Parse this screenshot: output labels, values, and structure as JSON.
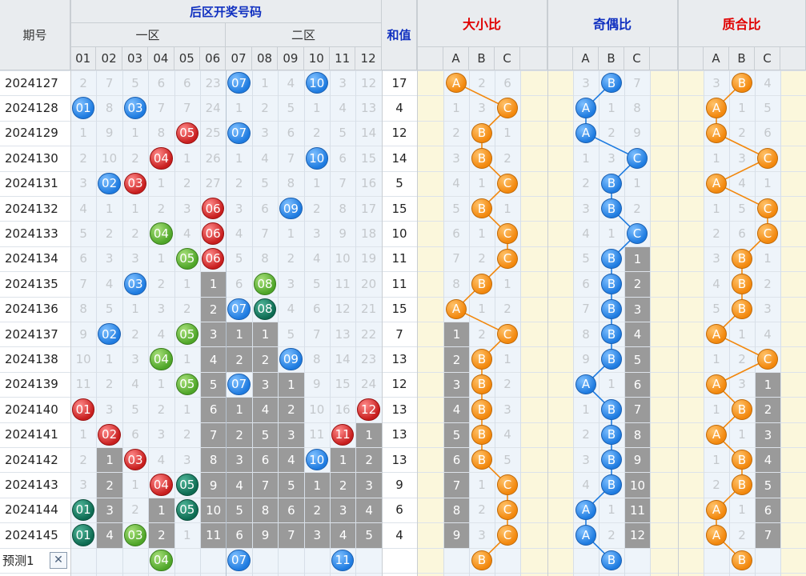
{
  "headers": {
    "period": "期号",
    "back_zone": "后区开奖号码",
    "zone1": "一区",
    "zone2": "二区",
    "sum": "和值",
    "big_small": "大小比",
    "odd_even": "奇偶比",
    "prime_composite": "质合比",
    "nums": [
      "01",
      "02",
      "03",
      "04",
      "05",
      "06",
      "07",
      "08",
      "09",
      "10",
      "11",
      "12"
    ],
    "abc": [
      "A",
      "B",
      "C"
    ]
  },
  "colors": {
    "blue": "#1e7be0",
    "red": "#c81e1e",
    "green": "#4ea528",
    "teal": "#0d6b52",
    "orange": "#f2870c",
    "dark": "#9a9a9a"
  },
  "rows": [
    {
      "period": "2024127",
      "cells": [
        "2",
        "7",
        "5",
        "6",
        "6",
        "23",
        "07",
        "1",
        "4",
        "10",
        "3",
        "12"
      ],
      "sum": "17",
      "bs": [
        "A",
        "2",
        "6"
      ],
      "oe": [
        "3",
        "B",
        "7"
      ],
      "pc": [
        "3",
        "B",
        "4"
      ]
    },
    {
      "period": "2024128",
      "cells": [
        "01",
        "8",
        "03",
        "7",
        "7",
        "24",
        "1",
        "2",
        "5",
        "1",
        "4",
        "13"
      ],
      "sum": "4",
      "bs": [
        "1",
        "3",
        "C"
      ],
      "oe": [
        "A",
        "1",
        "8"
      ],
      "pc": [
        "A",
        "1",
        "5"
      ]
    },
    {
      "period": "2024129",
      "cells": [
        "1",
        "9",
        "1",
        "8",
        "05",
        "25",
        "07",
        "3",
        "6",
        "2",
        "5",
        "14"
      ],
      "sum": "12",
      "bs": [
        "2",
        "B",
        "1"
      ],
      "oe": [
        "A",
        "2",
        "9"
      ],
      "pc": [
        "A",
        "2",
        "6"
      ]
    },
    {
      "period": "2024130",
      "cells": [
        "2",
        "10",
        "2",
        "04",
        "1",
        "26",
        "1",
        "4",
        "7",
        "10",
        "6",
        "15"
      ],
      "sum": "14",
      "bs": [
        "3",
        "B",
        "2"
      ],
      "oe": [
        "1",
        "3",
        "C"
      ],
      "pc": [
        "1",
        "3",
        "C"
      ]
    },
    {
      "period": "2024131",
      "cells": [
        "3",
        "02",
        "03",
        "1",
        "2",
        "27",
        "2",
        "5",
        "8",
        "1",
        "7",
        "16"
      ],
      "sum": "5",
      "bs": [
        "4",
        "1",
        "C"
      ],
      "oe": [
        "2",
        "B",
        "1"
      ],
      "pc": [
        "A",
        "4",
        "1"
      ]
    },
    {
      "period": "2024132",
      "cells": [
        "4",
        "1",
        "1",
        "2",
        "3",
        "06",
        "3",
        "6",
        "09",
        "2",
        "8",
        "17"
      ],
      "sum": "15",
      "bs": [
        "5",
        "B",
        "1"
      ],
      "oe": [
        "3",
        "B",
        "2"
      ],
      "pc": [
        "1",
        "5",
        "C"
      ]
    },
    {
      "period": "2024133",
      "cells": [
        "5",
        "2",
        "2",
        "04",
        "4",
        "06",
        "4",
        "7",
        "1",
        "3",
        "9",
        "18"
      ],
      "sum": "10",
      "bs": [
        "6",
        "1",
        "C"
      ],
      "oe": [
        "4",
        "1",
        "C"
      ],
      "pc": [
        "2",
        "6",
        "C"
      ]
    },
    {
      "period": "2024134",
      "cells": [
        "6",
        "3",
        "3",
        "1",
        "05",
        "06",
        "5",
        "8",
        "2",
        "4",
        "10",
        "19"
      ],
      "sum": "11",
      "bs": [
        "7",
        "2",
        "C"
      ],
      "oe": [
        "5",
        "B",
        "1"
      ],
      "pc": [
        "3",
        "B",
        "1"
      ]
    },
    {
      "period": "2024135",
      "cells": [
        "7",
        "4",
        "03",
        "2",
        "1",
        "1",
        "6",
        "08",
        "3",
        "5",
        "11",
        "20"
      ],
      "sum": "11",
      "bs": [
        "8",
        "B",
        "1"
      ],
      "oe": [
        "6",
        "B",
        "2"
      ],
      "pc": [
        "4",
        "B",
        "2"
      ]
    },
    {
      "period": "2024136",
      "cells": [
        "8",
        "5",
        "1",
        "3",
        "2",
        "2",
        "07",
        "08",
        "4",
        "6",
        "12",
        "21"
      ],
      "sum": "15",
      "bs": [
        "A",
        "1",
        "2"
      ],
      "oe": [
        "7",
        "B",
        "3"
      ],
      "pc": [
        "5",
        "B",
        "3"
      ]
    },
    {
      "period": "2024137",
      "cells": [
        "9",
        "02",
        "2",
        "4",
        "05",
        "3",
        "1",
        "1",
        "5",
        "7",
        "13",
        "22"
      ],
      "sum": "7",
      "bs": [
        "1",
        "2",
        "C"
      ],
      "oe": [
        "8",
        "B",
        "4"
      ],
      "pc": [
        "A",
        "1",
        "4"
      ]
    },
    {
      "period": "2024138",
      "cells": [
        "10",
        "1",
        "3",
        "04",
        "1",
        "4",
        "2",
        "2",
        "09",
        "8",
        "14",
        "23"
      ],
      "sum": "13",
      "bs": [
        "2",
        "B",
        "1"
      ],
      "oe": [
        "9",
        "B",
        "5"
      ],
      "pc": [
        "1",
        "2",
        "C"
      ]
    },
    {
      "period": "2024139",
      "cells": [
        "11",
        "2",
        "4",
        "1",
        "05",
        "5",
        "07",
        "3",
        "1",
        "9",
        "15",
        "24"
      ],
      "sum": "12",
      "bs": [
        "3",
        "B",
        "2"
      ],
      "oe": [
        "A",
        "1",
        "6"
      ],
      "pc": [
        "A",
        "3",
        "1"
      ]
    },
    {
      "period": "2024140",
      "cells": [
        "01",
        "3",
        "5",
        "2",
        "1",
        "6",
        "1",
        "4",
        "2",
        "10",
        "16",
        "12"
      ],
      "sum": "13",
      "bs": [
        "4",
        "B",
        "3"
      ],
      "oe": [
        "1",
        "B",
        "7"
      ],
      "pc": [
        "1",
        "B",
        "2"
      ]
    },
    {
      "period": "2024141",
      "cells": [
        "1",
        "02",
        "6",
        "3",
        "2",
        "7",
        "2",
        "5",
        "3",
        "11",
        "11",
        "1"
      ],
      "sum": "13",
      "bs": [
        "5",
        "B",
        "4"
      ],
      "oe": [
        "2",
        "B",
        "8"
      ],
      "pc": [
        "A",
        "1",
        "3"
      ]
    },
    {
      "period": "2024142",
      "cells": [
        "2",
        "1",
        "03",
        "4",
        "3",
        "8",
        "3",
        "6",
        "4",
        "10",
        "1",
        "2"
      ],
      "sum": "13",
      "bs": [
        "6",
        "B",
        "5"
      ],
      "oe": [
        "3",
        "B",
        "9"
      ],
      "pc": [
        "1",
        "B",
        "4"
      ]
    },
    {
      "period": "2024143",
      "cells": [
        "3",
        "2",
        "1",
        "04",
        "05",
        "9",
        "4",
        "7",
        "5",
        "1",
        "2",
        "3"
      ],
      "sum": "9",
      "bs": [
        "7",
        "1",
        "C"
      ],
      "oe": [
        "4",
        "B",
        "10"
      ],
      "pc": [
        "2",
        "B",
        "5"
      ]
    },
    {
      "period": "2024144",
      "cells": [
        "01",
        "3",
        "2",
        "1",
        "05",
        "10",
        "5",
        "8",
        "6",
        "2",
        "3",
        "4"
      ],
      "sum": "6",
      "bs": [
        "8",
        "2",
        "C"
      ],
      "oe": [
        "A",
        "1",
        "11"
      ],
      "pc": [
        "A",
        "1",
        "6"
      ]
    },
    {
      "period": "2024145",
      "cells": [
        "01",
        "4",
        "03",
        "2",
        "1",
        "11",
        "6",
        "9",
        "7",
        "3",
        "4",
        "5"
      ],
      "sum": "4",
      "bs": [
        "9",
        "3",
        "C"
      ],
      "oe": [
        "A",
        "2",
        "12"
      ],
      "pc": [
        "A",
        "2",
        "7"
      ]
    }
  ],
  "prediction": {
    "label": "预测1",
    "close_icon": "close-icon",
    "balls": [
      "04",
      "07",
      "11"
    ],
    "bs": "B",
    "oe": "B",
    "pc": "B"
  }
}
